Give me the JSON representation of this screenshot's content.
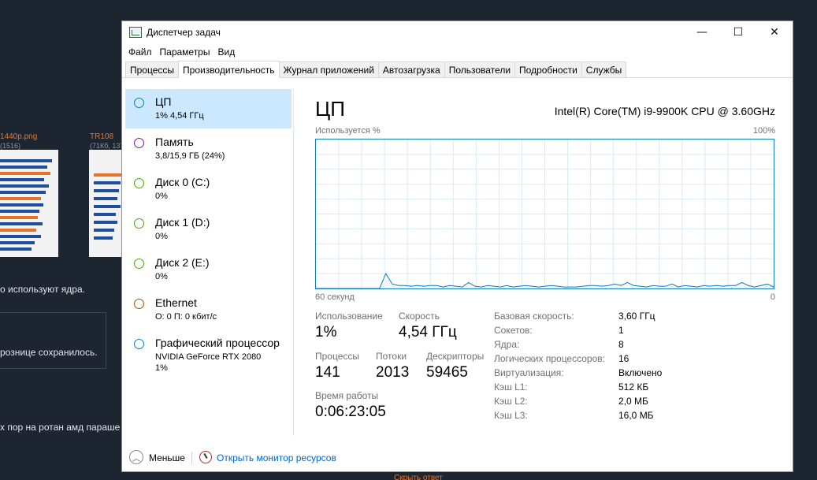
{
  "background": {
    "thumb1_name": "1440p.png",
    "thumb1_meta": "(1516)",
    "thumb2_name": "TR108",
    "thumb2_meta": "(71Кб, 137",
    "text1": "о используют ядра.",
    "text2": "рознице сохранилось.",
    "text3": "х пор на ротан амд параше",
    "bottom_link": "Скрыть ответ"
  },
  "window": {
    "title": "Диспетчер задач",
    "controls": {
      "minimize": "—",
      "maximize": "☐",
      "close": "✕"
    }
  },
  "menu": [
    "Файл",
    "Параметры",
    "Вид"
  ],
  "tabs": [
    "Процессы",
    "Производительность",
    "Журнал приложений",
    "Автозагрузка",
    "Пользователи",
    "Подробности",
    "Службы"
  ],
  "active_tab": "Производительность",
  "sidebar": [
    {
      "name": "ЦП",
      "sub": "1% 4,54 ГГц",
      "color": "#117dbb"
    },
    {
      "name": "Память",
      "sub": "3,8/15,9 ГБ (24%)",
      "color": "#8b12ae"
    },
    {
      "name": "Диск 0 (C:)",
      "sub": "0%",
      "color": "#4da60c"
    },
    {
      "name": "Диск 1 (D:)",
      "sub": "0%",
      "color": "#4da60c"
    },
    {
      "name": "Диск 2 (E:)",
      "sub": "0%",
      "color": "#4da60c"
    },
    {
      "name": "Ethernet",
      "sub": "О: 0 П: 0 кбит/с",
      "color": "#a74f01"
    },
    {
      "name": "Графический процессор",
      "sub": "NVIDIA GeForce RTX 2080",
      "sub2": "1%",
      "color": "#117dbb"
    }
  ],
  "main": {
    "title": "ЦП",
    "model": "Intel(R) Core(TM) i9-9900K CPU @ 3.60GHz",
    "graph_top_left": "Используется %",
    "graph_top_right": "100%",
    "graph_bottom_left": "60 секунд",
    "graph_bottom_right": "0",
    "stats": {
      "usage_label": "Использование",
      "usage_value": "1%",
      "speed_label": "Скорость",
      "speed_value": "4,54 ГГц",
      "processes_label": "Процессы",
      "processes_value": "141",
      "threads_label": "Потоки",
      "threads_value": "2013",
      "handles_label": "Дескрипторы",
      "handles_value": "59465",
      "uptime_label": "Время работы",
      "uptime_value": "0:06:23:05"
    },
    "specs": [
      {
        "k": "Базовая скорость:",
        "v": "3,60 ГГц"
      },
      {
        "k": "Сокетов:",
        "v": "1"
      },
      {
        "k": "Ядра:",
        "v": "8"
      },
      {
        "k": "Логических процессоров:",
        "v": "16"
      },
      {
        "k": "Виртуализация:",
        "v": "Включено"
      },
      {
        "k": "Кэш L1:",
        "v": "512 КБ"
      },
      {
        "k": "Кэш L2:",
        "v": "2,0 МБ"
      },
      {
        "k": "Кэш L3:",
        "v": "16,0 МБ"
      }
    ]
  },
  "cpu_history_percent": [
    0,
    0,
    0,
    0,
    0,
    0,
    0,
    0,
    0,
    0,
    0,
    10,
    3,
    2,
    2,
    1.5,
    2,
    1.5,
    2,
    2,
    1,
    2,
    1.5,
    1,
    4,
    1.5,
    1,
    2,
    1.5,
    1,
    2,
    1,
    1.5,
    2,
    1.5,
    1,
    1.5,
    2,
    1.5,
    1,
    1,
    1,
    1.5,
    2,
    2,
    1.5,
    2,
    3,
    2,
    4,
    2,
    1.5,
    1,
    2,
    1.5,
    1.5,
    3,
    1,
    2,
    1.5,
    1,
    2,
    1.5,
    2,
    1.5,
    2,
    2,
    4,
    2,
    1,
    2,
    3,
    1
  ],
  "footer": {
    "less": "Меньше",
    "resmon": "Открыть монитор ресурсов"
  }
}
